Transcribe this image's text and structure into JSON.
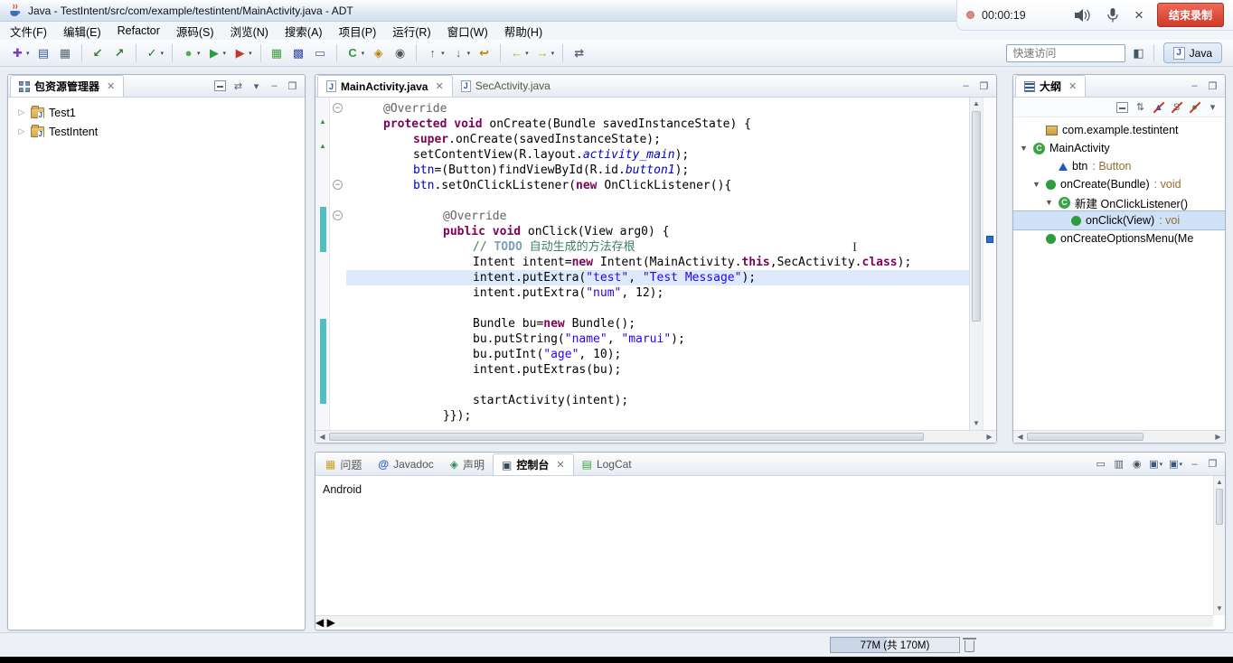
{
  "titlebar": {
    "title": "Java  -  TestIntent/src/com/example/testintent/MainActivity.java  -  ADT"
  },
  "recorder": {
    "time": "00:00:19",
    "stop_label": "结束录制"
  },
  "menubar": [
    "文件(F)",
    "编辑(E)",
    "Refactor",
    "源码(S)",
    "浏览(N)",
    "搜索(A)",
    "项目(P)",
    "运行(R)",
    "窗口(W)",
    "帮助(H)"
  ],
  "toolbar": {
    "quick_access_placeholder": "快速访问",
    "perspective_label": "Java",
    "groups": [
      [
        {
          "name": "new-wizard",
          "caret": true
        },
        {
          "name": "save"
        },
        {
          "name": "print"
        }
      ],
      [
        {
          "name": "import"
        },
        {
          "name": "export"
        }
      ],
      [
        {
          "name": "build",
          "caret": true
        }
      ],
      [
        {
          "name": "debug",
          "caret": true
        },
        {
          "name": "run",
          "caret": true
        },
        {
          "name": "run-external",
          "caret": true
        }
      ],
      [
        {
          "name": "new-android-project"
        },
        {
          "name": "android-sdk-manager"
        },
        {
          "name": "avd-manager"
        }
      ],
      [
        {
          "name": "new-java-class",
          "caret": true
        },
        {
          "name": "open-type"
        },
        {
          "name": "search"
        }
      ],
      [
        {
          "name": "prev-annotation",
          "caret": true
        },
        {
          "name": "next-annotation",
          "caret": true
        },
        {
          "name": "last-edit-location"
        }
      ],
      [
        {
          "name": "back",
          "caret": true
        },
        {
          "name": "forward",
          "caret": true
        }
      ],
      [
        {
          "name": "link-with-editor"
        }
      ]
    ]
  },
  "package_explorer": {
    "title": "包资源管理器",
    "toolbar": [
      "collapse-all",
      "link-with-editor",
      "view-menu",
      "minimize",
      "maximize"
    ],
    "items": [
      {
        "label": "Test1"
      },
      {
        "label": "TestIntent"
      }
    ]
  },
  "editor": {
    "tabs": [
      {
        "label": "MainActivity.java",
        "active": true
      },
      {
        "label": "SecActivity.java",
        "active": false
      }
    ],
    "actions": [
      "minimize",
      "maximize"
    ],
    "code_lines": [
      {
        "indent": 1,
        "fold": true,
        "segs": [
          [
            "@Override",
            "ann"
          ]
        ]
      },
      {
        "indent": 1,
        "segs": [
          [
            "protected void ",
            "kw"
          ],
          [
            "onCreate(Bundle savedInstanceState) {",
            "pl"
          ]
        ]
      },
      {
        "indent": 2,
        "segs": [
          [
            "super",
            "kw"
          ],
          [
            ".onCreate(savedInstanceState);",
            "pl"
          ]
        ]
      },
      {
        "indent": 2,
        "segs": [
          [
            "setContentView(R.layout.",
            "pl"
          ],
          [
            "activity_main",
            "sf"
          ],
          [
            ");",
            "pl"
          ]
        ]
      },
      {
        "indent": 2,
        "segs": [
          [
            "btn",
            "fd"
          ],
          [
            "=(Button)findViewById(R.id.",
            "pl"
          ],
          [
            "button1",
            "sf"
          ],
          [
            ");",
            "pl"
          ]
        ]
      },
      {
        "indent": 2,
        "fold": true,
        "segs": [
          [
            "btn",
            "fd"
          ],
          [
            ".setOnClickListener(",
            "pl"
          ],
          [
            "new",
            "kw"
          ],
          [
            " OnClickListener(){",
            "pl"
          ]
        ]
      },
      {
        "indent": 0,
        "segs": []
      },
      {
        "indent": 3,
        "fold": true,
        "segs": [
          [
            "@Override",
            "ann"
          ]
        ]
      },
      {
        "indent": 3,
        "segs": [
          [
            "public void ",
            "kw"
          ],
          [
            "onClick(View arg0) {",
            "pl"
          ]
        ]
      },
      {
        "indent": 4,
        "segs": [
          [
            "// ",
            "cm"
          ],
          [
            "TODO",
            "td"
          ],
          [
            " 自动生成的方法存根",
            "cm"
          ]
        ]
      },
      {
        "indent": 4,
        "segs": [
          [
            "Intent intent=",
            "pl"
          ],
          [
            "new",
            "kw"
          ],
          [
            " Intent(MainActivity.",
            "pl"
          ],
          [
            "this",
            "kw"
          ],
          [
            ",SecActivity.",
            "pl"
          ],
          [
            "class",
            "kw"
          ],
          [
            ");",
            "pl"
          ]
        ]
      },
      {
        "indent": 4,
        "hl": true,
        "segs": [
          [
            "intent.putExtra(",
            "pl"
          ],
          [
            "\"test\"",
            "st"
          ],
          [
            ", ",
            "pl"
          ],
          [
            "\"Test Message\"",
            "st"
          ],
          [
            ");",
            "pl"
          ]
        ]
      },
      {
        "indent": 4,
        "segs": [
          [
            "intent.putExtra(",
            "pl"
          ],
          [
            "\"num\"",
            "st"
          ],
          [
            ", 12);",
            "pl"
          ]
        ]
      },
      {
        "indent": 0,
        "segs": []
      },
      {
        "indent": 4,
        "segs": [
          [
            "Bundle bu=",
            "pl"
          ],
          [
            "new",
            "kw"
          ],
          [
            " Bundle();",
            "pl"
          ]
        ]
      },
      {
        "indent": 4,
        "segs": [
          [
            "bu.putString(",
            "pl"
          ],
          [
            "\"name\"",
            "st"
          ],
          [
            ", ",
            "pl"
          ],
          [
            "\"marui\"",
            "st"
          ],
          [
            ");",
            "pl"
          ]
        ]
      },
      {
        "indent": 4,
        "segs": [
          [
            "bu.putInt(",
            "pl"
          ],
          [
            "\"age\"",
            "st"
          ],
          [
            ", 10);",
            "pl"
          ]
        ]
      },
      {
        "indent": 4,
        "segs": [
          [
            "intent.putExtras(bu);",
            "pl"
          ]
        ]
      },
      {
        "indent": 0,
        "segs": []
      },
      {
        "indent": 4,
        "segs": [
          [
            "startActivity(intent);",
            "pl"
          ]
        ]
      },
      {
        "indent": 3,
        "segs": [
          [
            "}});",
            "pl"
          ]
        ]
      }
    ]
  },
  "outline": {
    "title": "大纲",
    "actions": [
      "minimize",
      "maximize"
    ],
    "toolbar": [
      "collapse-all",
      "sort",
      "hide-fields",
      "hide-static-members",
      "hide-non-public-members",
      "view-menu"
    ],
    "items": [
      {
        "depth": 1,
        "icon": "package",
        "name": "com.example.testintent"
      },
      {
        "depth": 0,
        "expanded": true,
        "icon": "class",
        "name": "MainActivity"
      },
      {
        "depth": 2,
        "icon": "field",
        "name": "btn",
        "type": "Button"
      },
      {
        "depth": 1,
        "expanded": true,
        "icon": "method",
        "name": "onCreate(Bundle)",
        "type": "void"
      },
      {
        "depth": 2,
        "expanded": true,
        "icon": "class",
        "name": "新建 OnClickListener()"
      },
      {
        "depth": 3,
        "icon": "method",
        "name": "onClick(View)",
        "type": "voi",
        "selected": true
      },
      {
        "depth": 1,
        "icon": "method",
        "name": "onCreateOptionsMenu(Me"
      }
    ]
  },
  "console": {
    "tabs": [
      {
        "label": "问题",
        "icon": "problems"
      },
      {
        "label": "Javadoc",
        "icon": "javadoc"
      },
      {
        "label": "声明",
        "icon": "declaration"
      },
      {
        "label": "控制台",
        "icon": "console",
        "active": true
      },
      {
        "label": "LogCat",
        "icon": "logcat"
      }
    ],
    "toolbar": [
      "clear-console",
      "scroll-lock",
      "pin-console",
      "display-selected-console",
      "open-console",
      "minimize",
      "maximize"
    ],
    "content": "Android"
  },
  "statusbar": {
    "memory": "77M  (共 170M)"
  }
}
